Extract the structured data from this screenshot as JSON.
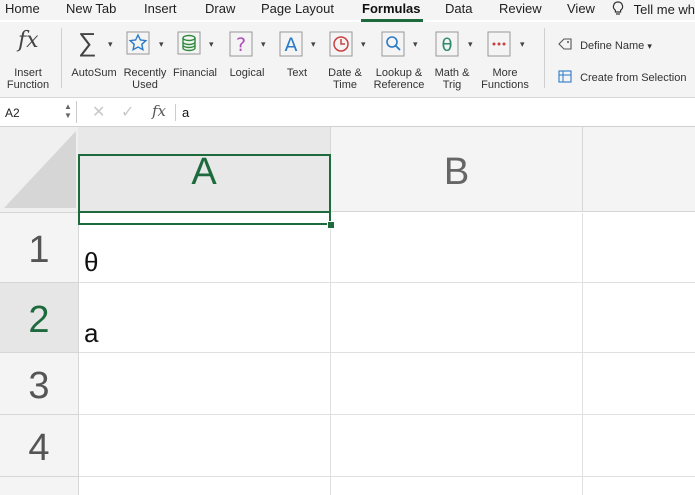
{
  "menu": {
    "items": [
      "Home",
      "New Tab",
      "Insert",
      "Draw",
      "Page Layout",
      "Formulas",
      "Data",
      "Review",
      "View"
    ],
    "active": "Formulas",
    "tell_me": "Tell me wh"
  },
  "ribbon": {
    "insert_function": "Insert\nFunction",
    "autosum": "AutoSum",
    "recently_used": "Recently\nUsed",
    "financial": "Financial",
    "logical": "Logical",
    "text": "Text",
    "date_time": "Date &\nTime",
    "lookup_reference": "Lookup &\nReference",
    "math_trig": "Math &\nTrig",
    "more_functions": "More\nFunctions",
    "define_name": "Define Name",
    "create_from_selection": "Create from Selection"
  },
  "formula_bar": {
    "name_box": "A2",
    "fx_label": "fx",
    "content": "a"
  },
  "grid": {
    "columns": [
      "A",
      "B"
    ],
    "rows": [
      "1",
      "2",
      "3",
      "4"
    ],
    "cells": {
      "A1": "θ",
      "A2": "a"
    },
    "selected_cell": "A2"
  },
  "colors": {
    "accent": "#1d6b3c",
    "header_bg": "#f4f4f4"
  }
}
